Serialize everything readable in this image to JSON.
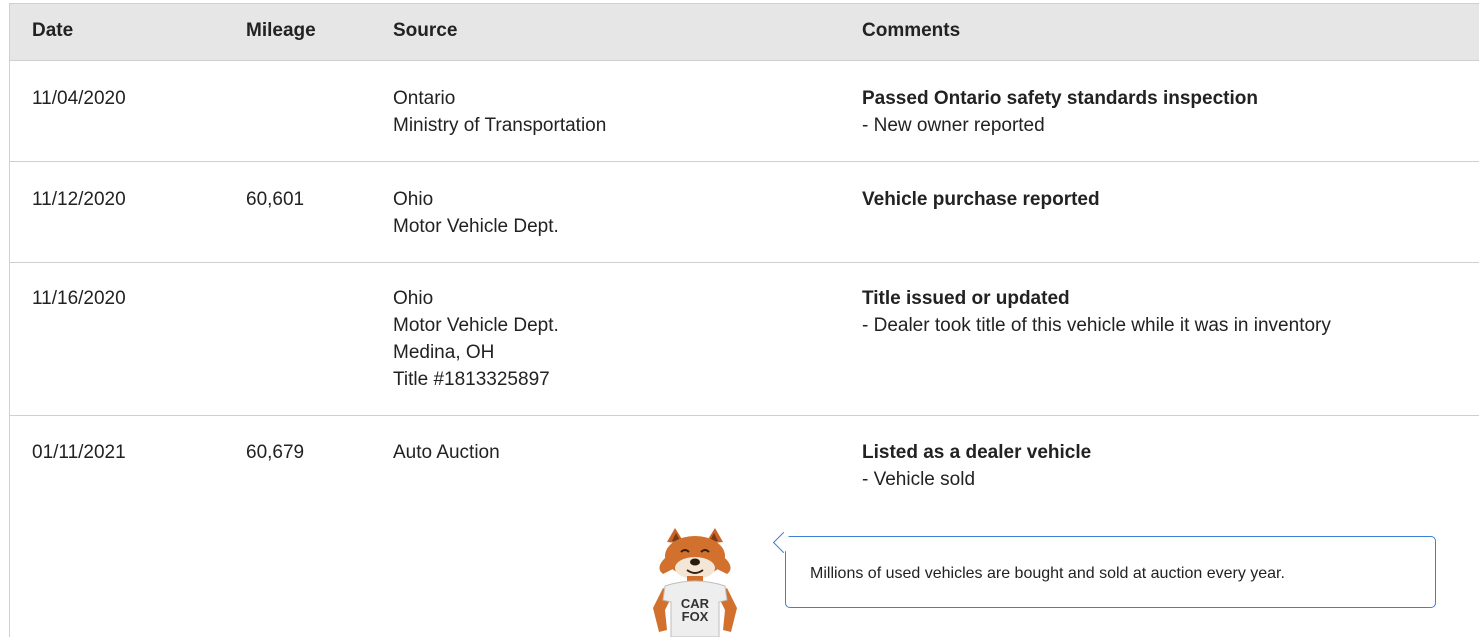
{
  "table": {
    "headers": {
      "date": "Date",
      "mileage": "Mileage",
      "source": "Source",
      "comments": "Comments"
    },
    "rows": [
      {
        "date": "11/04/2020",
        "mileage": "",
        "source": [
          "Ontario",
          "Ministry of Transportation"
        ],
        "comment_title": "Passed Ontario safety standards inspection",
        "comment_detail": "- New owner reported"
      },
      {
        "date": "11/12/2020",
        "mileage": "60,601",
        "source": [
          "Ohio",
          "Motor Vehicle Dept."
        ],
        "comment_title": "Vehicle purchase reported",
        "comment_detail": ""
      },
      {
        "date": "11/16/2020",
        "mileage": "",
        "source": [
          "Ohio",
          "Motor Vehicle Dept.",
          "Medina, OH",
          "Title #1813325897"
        ],
        "comment_title": "Title issued or updated",
        "comment_detail": "- Dealer took title of this vehicle while it was in inventory"
      },
      {
        "date": "01/11/2021",
        "mileage": "60,679",
        "source": [
          "Auto Auction"
        ],
        "comment_title": "Listed as a dealer vehicle",
        "comment_detail": "- Vehicle sold"
      }
    ]
  },
  "tip": {
    "text": "Millions of used vehicles are bought and sold at auction every year.",
    "mascot_shirt": [
      "CAR",
      "FOX"
    ],
    "border_color": "#3f7fd6"
  },
  "colors": {
    "header_bg": "#e6e6e6",
    "divider": "#cfcfcf"
  }
}
